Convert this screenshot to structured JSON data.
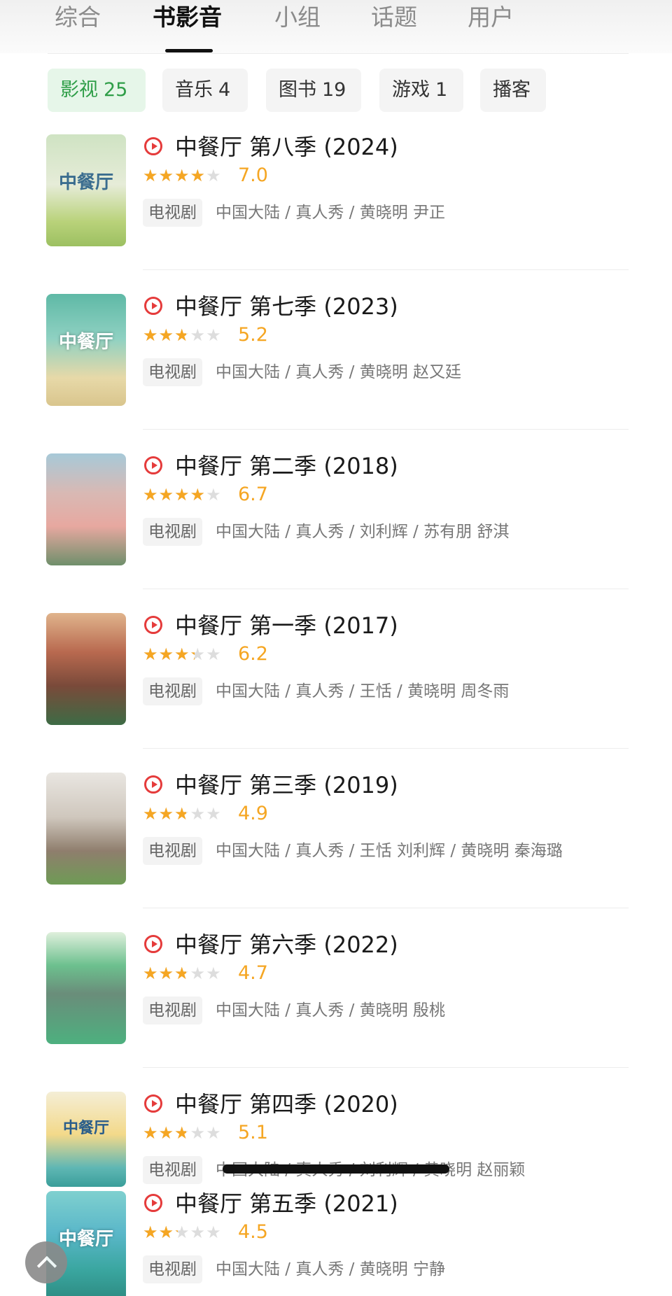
{
  "tabs": [
    {
      "label": "综合",
      "active": false
    },
    {
      "label": "书影音",
      "active": true
    },
    {
      "label": "小组",
      "active": false
    },
    {
      "label": "话题",
      "active": false
    },
    {
      "label": "用户",
      "active": false
    }
  ],
  "filters": [
    {
      "label": "影视",
      "count": "25",
      "active": true
    },
    {
      "label": "音乐",
      "count": "4",
      "active": false
    },
    {
      "label": "图书",
      "count": "19",
      "active": false
    },
    {
      "label": "游戏",
      "count": "1",
      "active": false
    },
    {
      "label": "播客",
      "count": "",
      "active": false
    }
  ],
  "results": [
    {
      "title": "中餐厅 第八季 (2024)",
      "rating": "7.0",
      "stars": 3.5,
      "type": "电视剧",
      "meta": "中国大陆 / 真人秀 / 黄晓明 尹正",
      "poster_icon": "poster-cartoon-landscape",
      "poster_text": "中餐厅"
    },
    {
      "title": "中餐厅 第七季 (2023)",
      "rating": "5.2",
      "stars": 2.5,
      "type": "电视剧",
      "meta": "中国大陆 / 真人秀 / 黄晓明 赵又廷",
      "poster_icon": "poster-carousel",
      "poster_text": "中餐厅"
    },
    {
      "title": "中餐厅 第二季 (2018)",
      "rating": "6.7",
      "stars": 3.5,
      "type": "电视剧",
      "meta": "中国大陆 / 真人秀 / 刘利辉 / 苏有朋 舒淇",
      "poster_icon": "poster-cast-photo",
      "poster_text": ""
    },
    {
      "title": "中餐厅 第一季 (2017)",
      "rating": "6.2",
      "stars": 3,
      "type": "电视剧",
      "meta": "中国大陆 / 真人秀 / 王恬 / 黄晓明 周冬雨",
      "poster_icon": "poster-cast-photo",
      "poster_text": ""
    },
    {
      "title": "中餐厅 第三季 (2019)",
      "rating": "4.9",
      "stars": 2.5,
      "type": "电视剧",
      "meta": "中国大陆 / 真人秀 / 王恬 刘利辉 / 黄晓明 秦海璐",
      "poster_icon": "poster-cast-photo",
      "poster_text": ""
    },
    {
      "title": "中餐厅 第六季 (2022)",
      "rating": "4.7",
      "stars": 2.5,
      "type": "电视剧",
      "meta": "中国大陆 / 真人秀 / 黄晓明 殷桃",
      "poster_icon": "poster-green-illustration",
      "poster_text": ""
    },
    {
      "title": "中餐厅 第四季 (2020)",
      "rating": "5.1",
      "stars": 2.5,
      "type": "电视剧",
      "meta": "中国大陆 / 真人秀 / 刘利辉 / 黄晓明 赵丽颖",
      "poster_icon": "poster-calendar-illustration",
      "poster_text": "中餐厅"
    },
    {
      "title": "中餐厅 第五季 (2021)",
      "rating": "4.5",
      "stars": 2,
      "type": "电视剧",
      "meta": "中国大陆 / 真人秀 / 黄晓明 宁静",
      "poster_icon": "poster-teal-illustration",
      "poster_text": "中餐厅"
    }
  ],
  "colors": {
    "accent_green": "#2f9e48",
    "star": "#f5a623",
    "play_red": "#e53b3b"
  }
}
